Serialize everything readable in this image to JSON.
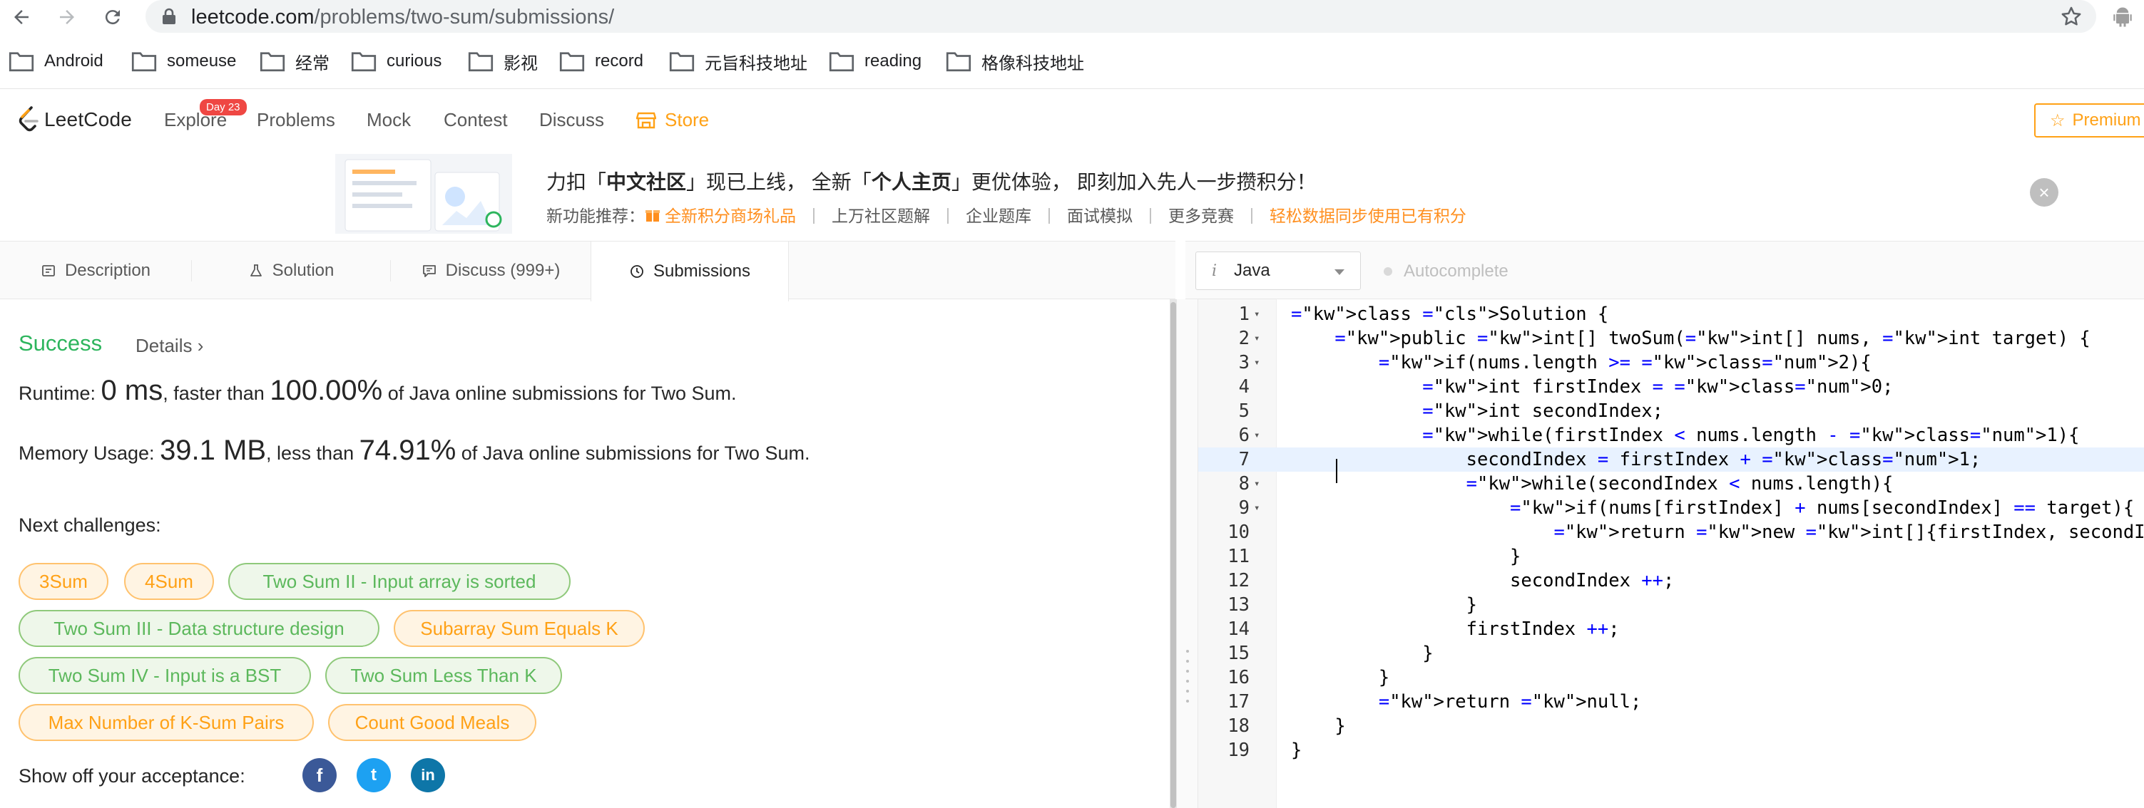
{
  "browser": {
    "url_host": "leetcode.com",
    "url_path": "/problems/two-sum/submissions/",
    "bookmarks": [
      "Android",
      "someuse",
      "经常",
      "curious",
      "影视",
      "record",
      "元旨科技地址",
      "reading",
      "格像科技地址"
    ]
  },
  "nav": {
    "logo": "LeetCode",
    "explore": "Explore",
    "explore_badge": "Day 23",
    "problems": "Problems",
    "mock": "Mock",
    "contest": "Contest",
    "discuss": "Discuss",
    "store": "Store",
    "premium": "Premium",
    "accent": "#ffa116"
  },
  "banner": {
    "title_pre": "力扣「",
    "title_b1": "中文社区",
    "title_mid": "」现已上线， 全新「",
    "title_b2": "个人主页",
    "title_post": "」更优体验， 即刻加入先人一步攒积分！",
    "sub_label": "新功能推荐：",
    "sub_items": [
      "全新积分商场礼品",
      "上万社区题解",
      "企业题库",
      "面试模拟",
      "更多竞赛",
      "轻松数据同步使用已有积分"
    ],
    "sub_sep": "|",
    "close": "×"
  },
  "tabs": {
    "description": "Description",
    "solution": "Solution",
    "discuss": "Discuss (999+)",
    "submissions": "Submissions"
  },
  "editor_bar": {
    "language": "Java",
    "lang_icon": "i",
    "autocomplete": "Autocomplete"
  },
  "result": {
    "status": "Success",
    "details": "Details ›",
    "runtime_label": "Runtime: ",
    "runtime_value": "0 ms",
    "runtime_mid": ", faster than ",
    "runtime_pct": "100.00%",
    "runtime_tail": " of Java online submissions for Two Sum.",
    "memory_label": "Memory Usage: ",
    "memory_value": "39.1 MB",
    "memory_mid": ", less than ",
    "memory_pct": "74.91%",
    "memory_tail": " of Java online submissions for Two Sum.",
    "success_color": "#2db55d"
  },
  "challenges": {
    "label": "Next challenges:",
    "items": [
      {
        "name": "3Sum",
        "level": "medium"
      },
      {
        "name": "4Sum",
        "level": "medium"
      },
      {
        "name": "Two Sum II - Input array is sorted",
        "level": "easy"
      },
      {
        "name": "Two Sum III - Data structure design",
        "level": "easy"
      },
      {
        "name": "Subarray Sum Equals K",
        "level": "medium"
      },
      {
        "name": "Two Sum IV - Input is a BST",
        "level": "easy"
      },
      {
        "name": "Two Sum Less Than K",
        "level": "easy"
      },
      {
        "name": "Max Number of K-Sum Pairs",
        "level": "medium"
      },
      {
        "name": "Count Good Meals",
        "level": "medium"
      }
    ]
  },
  "share": {
    "label": "Show off your acceptance:",
    "facebook": "f",
    "twitter": "t",
    "linkedin": "in"
  },
  "code": {
    "line_numbers": [
      "1",
      "2",
      "3",
      "4",
      "5",
      "6",
      "7",
      "8",
      "9",
      "10",
      "11",
      "12",
      "13",
      "14",
      "15",
      "16",
      "17",
      "18",
      "19"
    ],
    "fold_marker": "▾",
    "active_line": 7,
    "lines": [
      "class Solution {",
      "    public int[] twoSum(int[] nums, int target) {",
      "        if(nums.length >= 2){",
      "            int firstIndex = 0;",
      "            int secondIndex;",
      "            while(firstIndex < nums.length - 1){",
      "                secondIndex = firstIndex + 1;",
      "                while(secondIndex < nums.length){",
      "                    if(nums[firstIndex] + nums[secondIndex] == target){",
      "                        return new int[]{firstIndex, secondIndex};",
      "                    }",
      "                    secondIndex ++;",
      "                }",
      "                firstIndex ++;",
      "            }",
      "        }",
      "        return null;",
      "    }",
      "}"
    ]
  }
}
